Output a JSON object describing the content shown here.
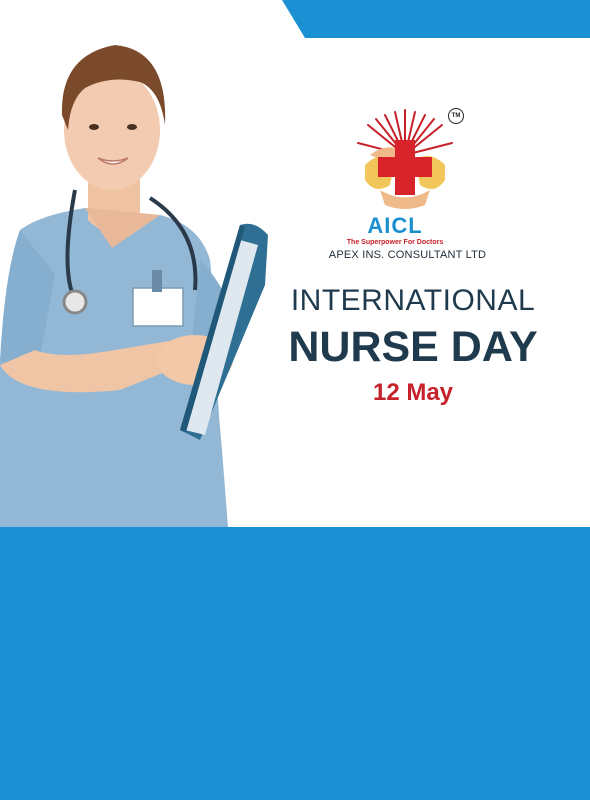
{
  "brand": {
    "abbr": "AICL",
    "tagline": "The Superpower For Doctors",
    "name": "APEX INS. CONSULTANT LTD",
    "trademark": "TM"
  },
  "headline": {
    "line1": "INTERNATIONAL",
    "line2": "NURSE DAY",
    "date": "12 May"
  },
  "colors": {
    "accent_blue": "#1b90d2",
    "headline_navy": "#1f3a4d",
    "date_red": "#c7212a",
    "logo_blue": "#1b8fd0"
  },
  "icons": {
    "logo": "medical-cross-hands-icon",
    "photo": "nurse-with-clipboard-photo"
  }
}
